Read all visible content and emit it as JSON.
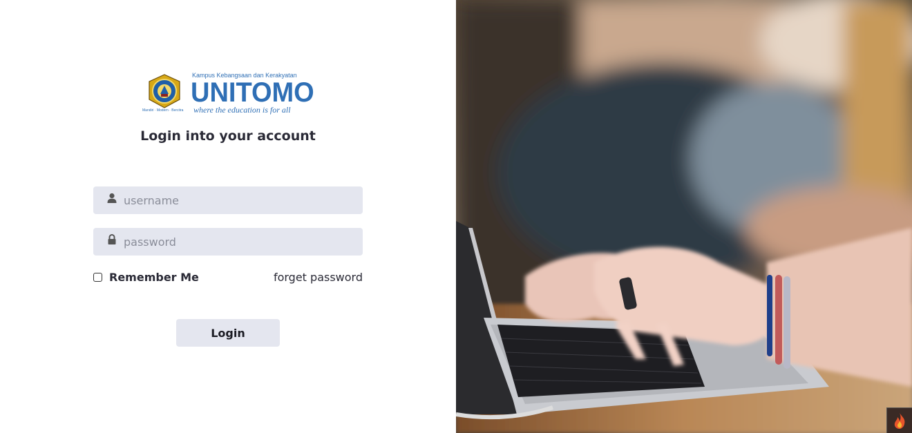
{
  "logo": {
    "tagline_top": "Kampus Kebangsaan dan Kerakyatan",
    "brand": "UNITOMO",
    "motto": "where the education is for all",
    "seal_tagline": "Mandiri · Modern · Bercitra",
    "icon": "unitomo-seal-icon"
  },
  "login": {
    "title": "Login into your account",
    "username_placeholder": "username",
    "password_placeholder": "password",
    "remember_label": "Remember Me",
    "forget_label": "forget password",
    "button_label": "Login",
    "user_icon": "user-icon",
    "lock_icon": "lock-icon"
  },
  "hero": {
    "image": "hands-typing-on-laptop-photo",
    "corner_icon": "flame-icon"
  },
  "colors": {
    "brand_blue": "#2f6fb5",
    "field_bg": "#e4e6ef",
    "title_text": "#2a2a36"
  }
}
